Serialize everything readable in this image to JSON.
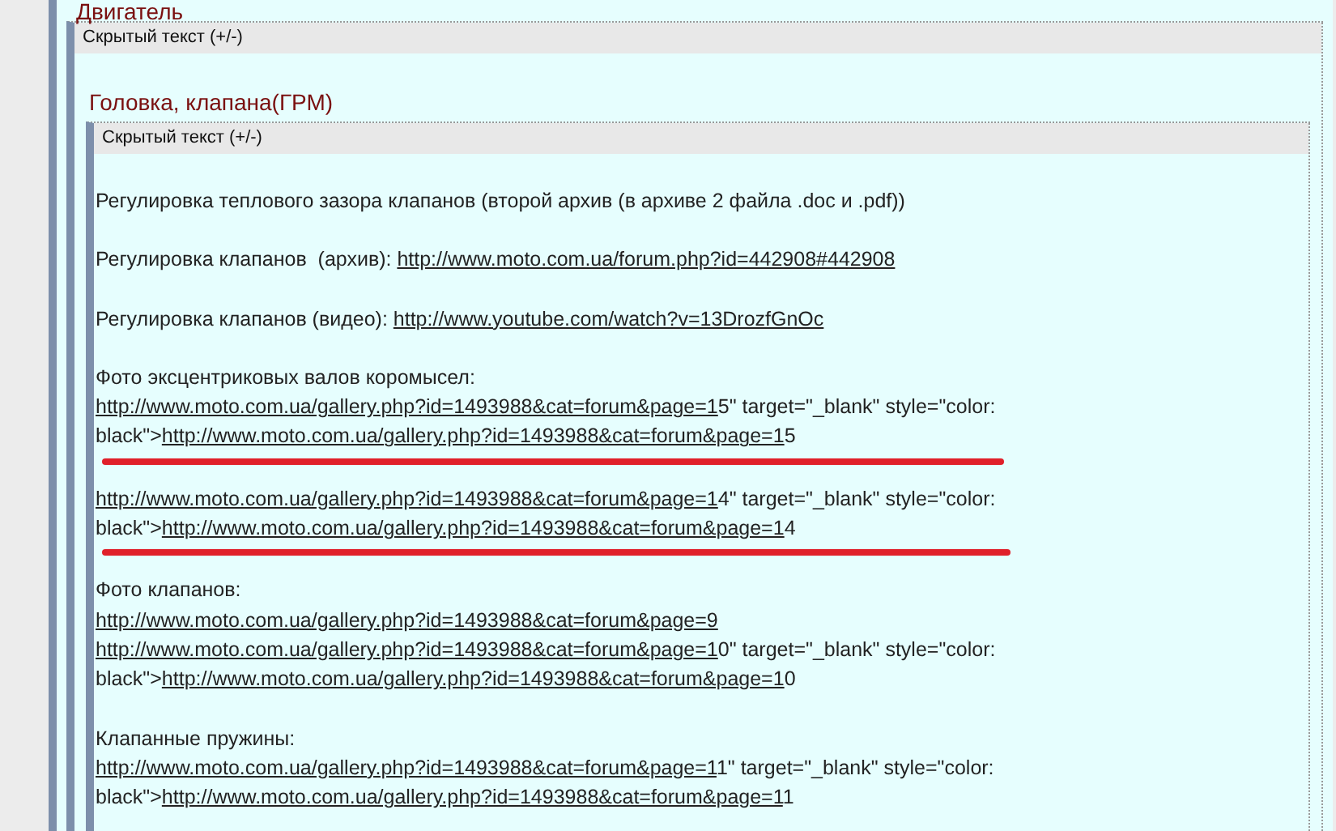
{
  "section_title": "Двигатель",
  "spoiler": {
    "toggle": "Скрытый текст (+/-)",
    "subsection_title": "Головка, клапана(ГРМ)",
    "inner_spoiler": {
      "toggle": "Скрытый текст (+/-)",
      "paragraphs": [
        {
          "marked": false,
          "lines": [
            [
              {
                "kind": "text",
                "text": "Регулировка теплового зазора клапанов (второй архив (в архиве 2 файла .doc и .pdf))"
              }
            ]
          ]
        },
        {
          "marked": false,
          "lines": [
            [
              {
                "kind": "text",
                "text": "Регулировка клапанов  (архив): "
              },
              {
                "kind": "link",
                "text": "http://www.moto.com.ua/forum.php?id=442908#442908"
              }
            ]
          ]
        },
        {
          "marked": false,
          "lines": [
            [
              {
                "kind": "text",
                "text": "Регулировка клапанов (видео): "
              },
              {
                "kind": "link",
                "text": "http://www.youtube.com/watch?v=13DrozfGnOc"
              }
            ]
          ]
        },
        {
          "marked": true,
          "lines": [
            [
              {
                "kind": "text",
                "text": "Фото эксцентриковых валов коромысел:"
              }
            ],
            [
              {
                "kind": "link",
                "text": "http://www.moto.com.ua/gallery.php?id=1493988&cat=forum&page=1"
              },
              {
                "kind": "text",
                "text": "5\" target=\"_blank\" style=\"color:"
              }
            ],
            [
              {
                "kind": "text",
                "text": "black\">"
              },
              {
                "kind": "link",
                "text": "http://www.moto.com.ua/gallery.php?id=1493988&cat=forum&page=1"
              },
              {
                "kind": "text",
                "text": "5"
              }
            ]
          ]
        },
        {
          "marked": true,
          "lines": [
            [
              {
                "kind": "link",
                "text": "http://www.moto.com.ua/gallery.php?id=1493988&cat=forum&page=1"
              },
              {
                "kind": "text",
                "text": "4\" target=\"_blank\" style=\"color:"
              }
            ],
            [
              {
                "kind": "text",
                "text": "black\">"
              },
              {
                "kind": "link",
                "text": "http://www.moto.com.ua/gallery.php?id=1493988&cat=forum&page=1"
              },
              {
                "kind": "text",
                "text": "4"
              }
            ]
          ]
        },
        {
          "marked": false,
          "lines": [
            [
              {
                "kind": "text",
                "text": "Фото клапанов:"
              }
            ],
            [
              {
                "kind": "link",
                "text": "http://www.moto.com.ua/gallery.php?id=1493988&cat=forum&page=9"
              }
            ],
            [
              {
                "kind": "link",
                "text": "http://www.moto.com.ua/gallery.php?id=1493988&cat=forum&page=1"
              },
              {
                "kind": "text",
                "text": "0\" target=\"_blank\" style=\"color:"
              }
            ],
            [
              {
                "kind": "text",
                "text": "black\">"
              },
              {
                "kind": "link",
                "text": "http://www.moto.com.ua/gallery.php?id=1493988&cat=forum&page=1"
              },
              {
                "kind": "text",
                "text": "0"
              }
            ]
          ]
        },
        {
          "marked": false,
          "lines": [
            [
              {
                "kind": "text",
                "text": "Клапанные пружины:"
              }
            ],
            [
              {
                "kind": "link",
                "text": "http://www.moto.com.ua/gallery.php?id=1493988&cat=forum&page=1"
              },
              {
                "kind": "text",
                "text": "1\" target=\"_blank\" style=\"color:"
              }
            ],
            [
              {
                "kind": "text",
                "text": "black\">"
              },
              {
                "kind": "link",
                "text": "http://www.moto.com.ua/gallery.php?id=1493988&cat=forum&page=1"
              },
              {
                "kind": "text",
                "text": "1"
              }
            ]
          ]
        }
      ]
    }
  }
}
